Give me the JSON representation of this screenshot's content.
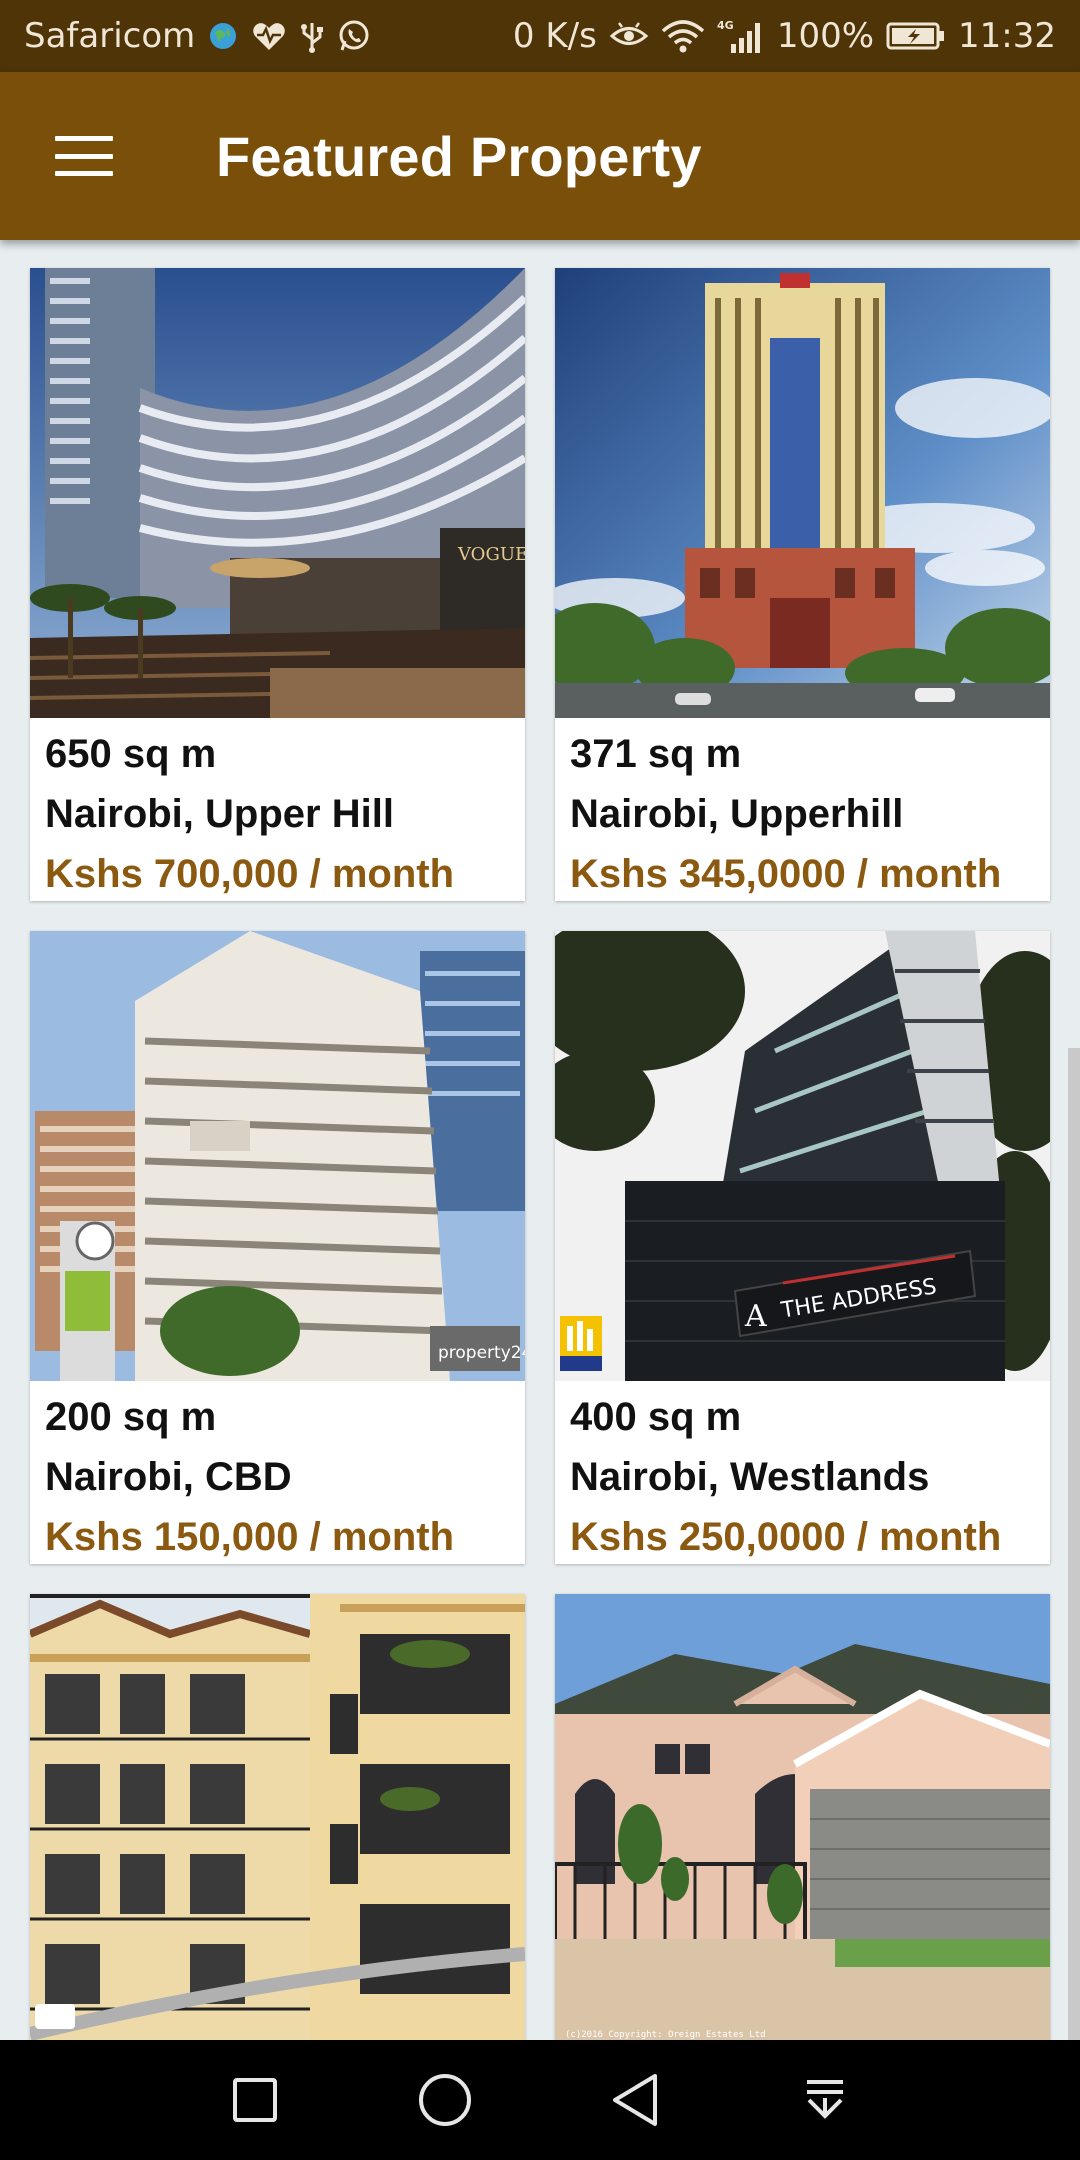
{
  "status_bar": {
    "carrier": "Safaricom",
    "speed": "0 K/s",
    "network": "4G",
    "battery": "100%",
    "time": "11:32"
  },
  "app_bar": {
    "title": "Featured Property"
  },
  "colors": {
    "status_bar": "#4e3406",
    "app_bar": "#7a4f0a",
    "price_text": "#8b5a10",
    "background": "#e8eef0"
  },
  "properties": [
    {
      "size": "650 sq m",
      "location": "Nairobi, Upper Hill",
      "price": "Kshs 700,000 / month",
      "image": "curved-glass-highrise-complex"
    },
    {
      "size": "371 sq m",
      "location": "Nairobi, Upperhill",
      "price": "Kshs 345,0000 / month",
      "image": "tall-cream-tower"
    },
    {
      "size": "200 sq m",
      "location": "Nairobi, CBD",
      "price": "Kshs 150,000 / month",
      "image": "white-office-block",
      "image_text": "property24"
    },
    {
      "size": "400 sq m",
      "location": "Nairobi, Westlands",
      "price": "Kshs 250,0000 / month",
      "image": "dark-glass-office-building",
      "image_text": "THE ADDRESS"
    },
    {
      "size": "",
      "location": "",
      "price": "",
      "image": "yellow-apartment-block"
    },
    {
      "size": "",
      "location": "",
      "price": "",
      "image": "pink-townhouses"
    }
  ],
  "nav_bar": {
    "buttons": [
      "recent-apps",
      "home",
      "back",
      "notifications"
    ]
  }
}
